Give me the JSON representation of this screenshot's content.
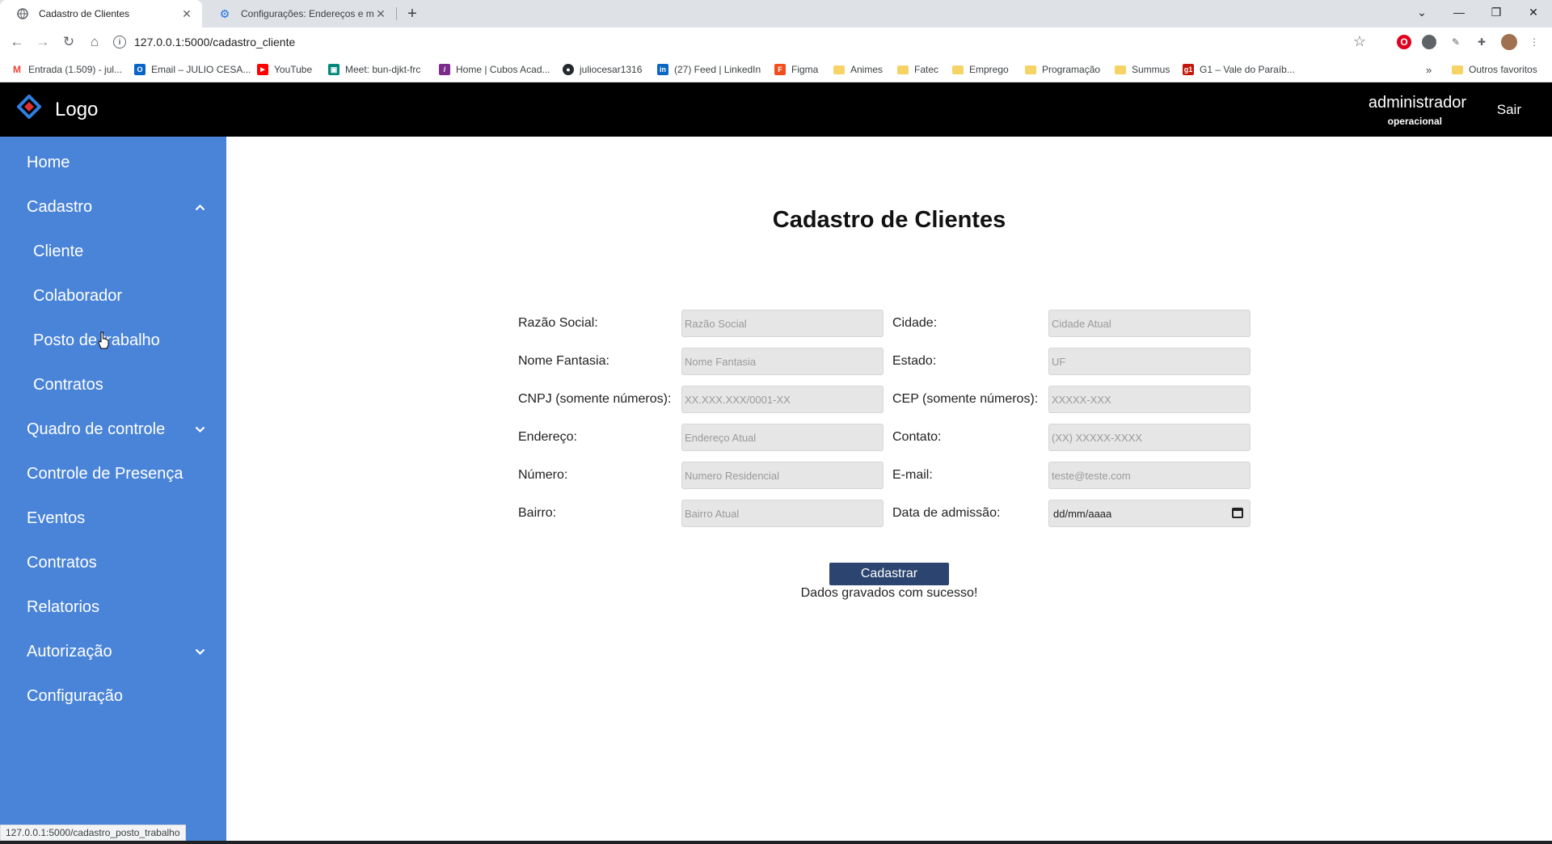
{
  "browser": {
    "tabs": [
      {
        "title": "Cadastro de Clientes",
        "icon": "globe-icon",
        "active": true
      },
      {
        "title": "Configurações: Endereços e mais",
        "icon": "gear-icon",
        "active": false
      }
    ],
    "url": "127.0.0.1:5000/cadastro_cliente",
    "bookmarks": [
      {
        "label": "Entrada (1.509) - jul...",
        "icon": "gmail-icon"
      },
      {
        "label": "Email – JULIO CESA...",
        "icon": "outlook-icon"
      },
      {
        "label": "YouTube",
        "icon": "youtube-icon"
      },
      {
        "label": "Meet: bun-djkt-frc",
        "icon": "meet-icon"
      },
      {
        "label": "Home | Cubos Acad...",
        "icon": "cubos-icon"
      },
      {
        "label": "juliocesar1316",
        "icon": "github-icon"
      },
      {
        "label": "(27) Feed | LinkedIn",
        "icon": "linkedin-icon"
      },
      {
        "label": "Figma",
        "icon": "figma-icon"
      },
      {
        "label": "Animes",
        "icon": "folder-icon"
      },
      {
        "label": "Fatec",
        "icon": "folder-icon"
      },
      {
        "label": "Emprego",
        "icon": "folder-icon"
      },
      {
        "label": "Programação",
        "icon": "folder-icon"
      },
      {
        "label": "Summus",
        "icon": "folder-icon"
      },
      {
        "label": "G1 – Vale do Paraíb...",
        "icon": "g1-icon"
      }
    ],
    "other_bookmarks": "Outros favoritos",
    "status_url": "127.0.0.1:5000/cadastro_posto_trabalho"
  },
  "header": {
    "logo": "Logo",
    "user_name": "administrador",
    "user_role": "operacional",
    "logout": "Sair"
  },
  "sidebar": {
    "items": [
      {
        "label": "Home",
        "level": "main"
      },
      {
        "label": "Cadastro",
        "level": "main",
        "chevron": "up"
      },
      {
        "label": "Cliente",
        "level": "sub"
      },
      {
        "label": "Colaborador",
        "level": "sub"
      },
      {
        "label": "Posto de trabalho",
        "level": "sub"
      },
      {
        "label": "Contratos",
        "level": "sub"
      },
      {
        "label": "Quadro de controle",
        "level": "main",
        "chevron": "down"
      },
      {
        "label": "Controle de Presença",
        "level": "main"
      },
      {
        "label": "Eventos",
        "level": "main"
      },
      {
        "label": "Contratos",
        "level": "main"
      },
      {
        "label": "Relatorios",
        "level": "main"
      },
      {
        "label": "Autorização",
        "level": "main",
        "chevron": "down"
      },
      {
        "label": "Configuração",
        "level": "main"
      }
    ]
  },
  "form": {
    "title": "Cadastro de Clientes",
    "left_fields": [
      {
        "label": "Razão Social:",
        "placeholder": "Razão Social"
      },
      {
        "label": "Nome Fantasia:",
        "placeholder": "Nome Fantasia"
      },
      {
        "label": "CNPJ (somente números):",
        "placeholder": "XX.XXX.XXX/0001-XX"
      },
      {
        "label": "Endereço:",
        "placeholder": "Endereço Atual"
      },
      {
        "label": "Número:",
        "placeholder": "Numero Residencial"
      },
      {
        "label": "Bairro:",
        "placeholder": "Bairro Atual"
      }
    ],
    "right_fields": [
      {
        "label": "Cidade:",
        "placeholder": "Cidade Atual"
      },
      {
        "label": "Estado:",
        "placeholder": "UF"
      },
      {
        "label": "CEP (somente números):",
        "placeholder": "XXXXX-XXX"
      },
      {
        "label": "Contato:",
        "placeholder": "(XX) XXXXX-XXXX"
      },
      {
        "label": "E-mail:",
        "placeholder": "teste@teste.com"
      },
      {
        "label": "Data de admissão:",
        "value": "dd/mm/aaaa",
        "type": "date"
      }
    ],
    "submit_label": "Cadastrar",
    "success_message": "Dados gravados com sucesso!"
  }
}
